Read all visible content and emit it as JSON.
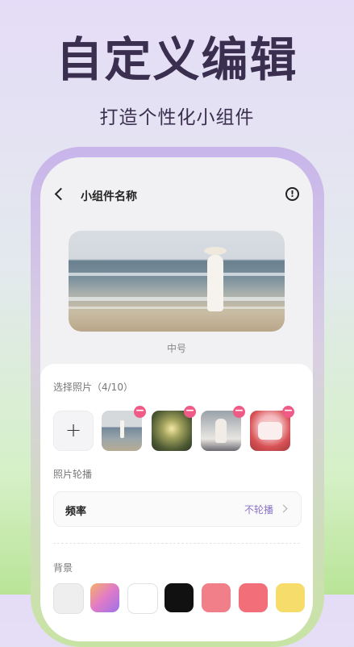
{
  "hero": {
    "title": "自定义编辑",
    "subtitle": "打造个性化小组件"
  },
  "header": {
    "title": "小组件名称",
    "info_glyph": "!",
    "back_icon": "chevron-left-icon",
    "info_icon": "info-circle-icon"
  },
  "preview": {
    "size_label": "中号"
  },
  "photos": {
    "label": "选择照片（4/10）",
    "add_glyph": "+",
    "remove_glyph": "−",
    "items": [
      "beach-photo",
      "sparkle-photo",
      "portrait-photo",
      "cake-photo"
    ]
  },
  "carousel": {
    "label": "照片轮播",
    "frequency_label": "频率",
    "frequency_value": "不轮播"
  },
  "background": {
    "label": "背景",
    "swatches": [
      "#eeeeee",
      "#d68ee0",
      "#ffffff",
      "#111111",
      "#f07f8a",
      "#f26f7a",
      "#f6dc6b"
    ]
  },
  "colors": {
    "accent": "#8b74c6",
    "remove_badge": "#ef5a87",
    "title_text": "#3b2f4f"
  }
}
